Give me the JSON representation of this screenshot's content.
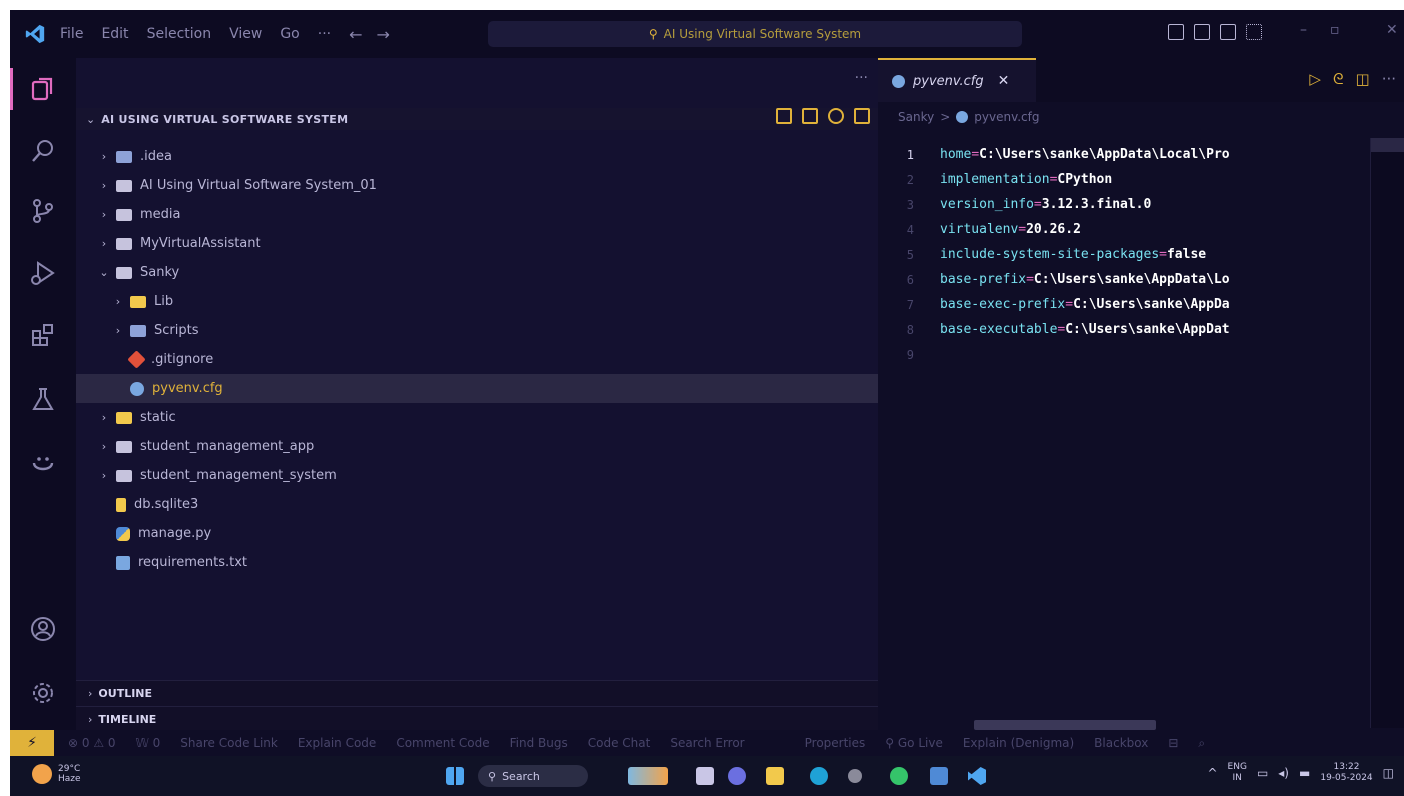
{
  "titlebar": {
    "menus": [
      "File",
      "Edit",
      "Selection",
      "View",
      "Go",
      "···"
    ],
    "back_arrow": "←",
    "forward_arrow": "→",
    "search_text": "AI Using Virtual Software System",
    "icons": [
      "search-icon",
      "toggle-sidebar-icon",
      "toggle-panel-icon",
      "toggle-secondary-sidebar-icon",
      "customize-layout-icon"
    ]
  },
  "activity_bar": [
    "explorer-icon",
    "search-icon",
    "source-control-icon",
    "run-debug-icon",
    "extensions-icon",
    "testing-icon",
    "copilot-icon",
    "account-icon",
    "settings-icon"
  ],
  "sidebar": {
    "more": "···",
    "project_title": "AI USING VIRTUAL SOFTWARE SYSTEM",
    "tree": [
      {
        "label": ".idea",
        "kind": "folder-b",
        "depth": 1,
        "twisty": "›"
      },
      {
        "label": "AI Using Virtual Software System_01",
        "kind": "folder",
        "depth": 1,
        "twisty": "›"
      },
      {
        "label": "media",
        "kind": "folder",
        "depth": 1,
        "twisty": "›"
      },
      {
        "label": "MyVirtualAssistant",
        "kind": "folder",
        "depth": 1,
        "twisty": "›"
      },
      {
        "label": "Sanky",
        "kind": "folder",
        "depth": 1,
        "twisty": "⌄"
      },
      {
        "label": "Lib",
        "kind": "folder-y",
        "depth": 2,
        "twisty": "›"
      },
      {
        "label": "Scripts",
        "kind": "folder-b",
        "depth": 2,
        "twisty": "›"
      },
      {
        "label": ".gitignore",
        "kind": "file-git",
        "depth": 2,
        "twisty": ""
      },
      {
        "label": "pyvenv.cfg",
        "kind": "file-cfg",
        "depth": 2,
        "twisty": "",
        "selected": true
      },
      {
        "label": "static",
        "kind": "folder-y",
        "depth": 1,
        "twisty": "›"
      },
      {
        "label": "student_management_app",
        "kind": "folder",
        "depth": 1,
        "twisty": "›"
      },
      {
        "label": "student_management_system",
        "kind": "folder",
        "depth": 1,
        "twisty": "›"
      },
      {
        "label": "db.sqlite3",
        "kind": "file-db",
        "depth": 1,
        "twisty": ""
      },
      {
        "label": "manage.py",
        "kind": "file-py",
        "depth": 1,
        "twisty": ""
      },
      {
        "label": "requirements.txt",
        "kind": "file-txt",
        "depth": 1,
        "twisty": ""
      }
    ],
    "outline": "OUTLINE",
    "timeline": "TIMELINE"
  },
  "editor": {
    "tab_label": "pyvenv.cfg",
    "tab_close": "✕",
    "breadcrumb_folder": "Sanky",
    "breadcrumb_sep": ">",
    "breadcrumb_file": "pyvenv.cfg",
    "tab_actions": [
      "▷",
      "ᘓ",
      "◫",
      "···"
    ],
    "lines": [
      {
        "n": "1",
        "key": "home",
        "op": " = ",
        "val": "C:\\Users\\sanke\\AppData\\Local\\Pro"
      },
      {
        "n": "2",
        "key": "implementation",
        "op": " = ",
        "val": "CPython"
      },
      {
        "n": "3",
        "key": "version_info",
        "op": " = ",
        "val": "3.12.3.final.0"
      },
      {
        "n": "4",
        "key": "virtualenv",
        "op": " = ",
        "val": "20.26.2"
      },
      {
        "n": "5",
        "key": "include-system-site-packages",
        "op": " = ",
        "val": "false"
      },
      {
        "n": "6",
        "key": "base-prefix",
        "op": " = ",
        "val": "C:\\Users\\sanke\\AppData\\Lo"
      },
      {
        "n": "7",
        "key": "base-exec-prefix",
        "op": " = ",
        "val": "C:\\Users\\sanke\\AppDa"
      },
      {
        "n": "8",
        "key": "base-executable",
        "op": " = ",
        "val": "C:\\Users\\sanke\\AppDat"
      },
      {
        "n": "9",
        "key": "",
        "op": "",
        "val": ""
      }
    ]
  },
  "statusbar": {
    "remote_icon": "⚡",
    "items": [
      "⊗ 0 ⚠ 0",
      "𝕎 0",
      "Share Code Link",
      "Explain Code",
      "Comment Code",
      "Find Bugs",
      "Code Chat",
      "Search Error"
    ],
    "right_items": [
      "Properties",
      "⚲ Go Live",
      "Explain (Denigma)",
      "Blackbox",
      "⊟",
      "⌕"
    ]
  },
  "taskbar": {
    "weather_temp": "29°C",
    "weather_desc": "Haze",
    "search_label": "Search",
    "tray_lang_1": "ENG",
    "tray_lang_2": "IN",
    "tray_time": "13:22",
    "tray_date": "19-05-2024",
    "tray_chevron": "^"
  },
  "colors": {
    "accent": "#e0b23a",
    "background": "#12102a",
    "key": "#79e1f0",
    "operator": "#e06bbf"
  }
}
